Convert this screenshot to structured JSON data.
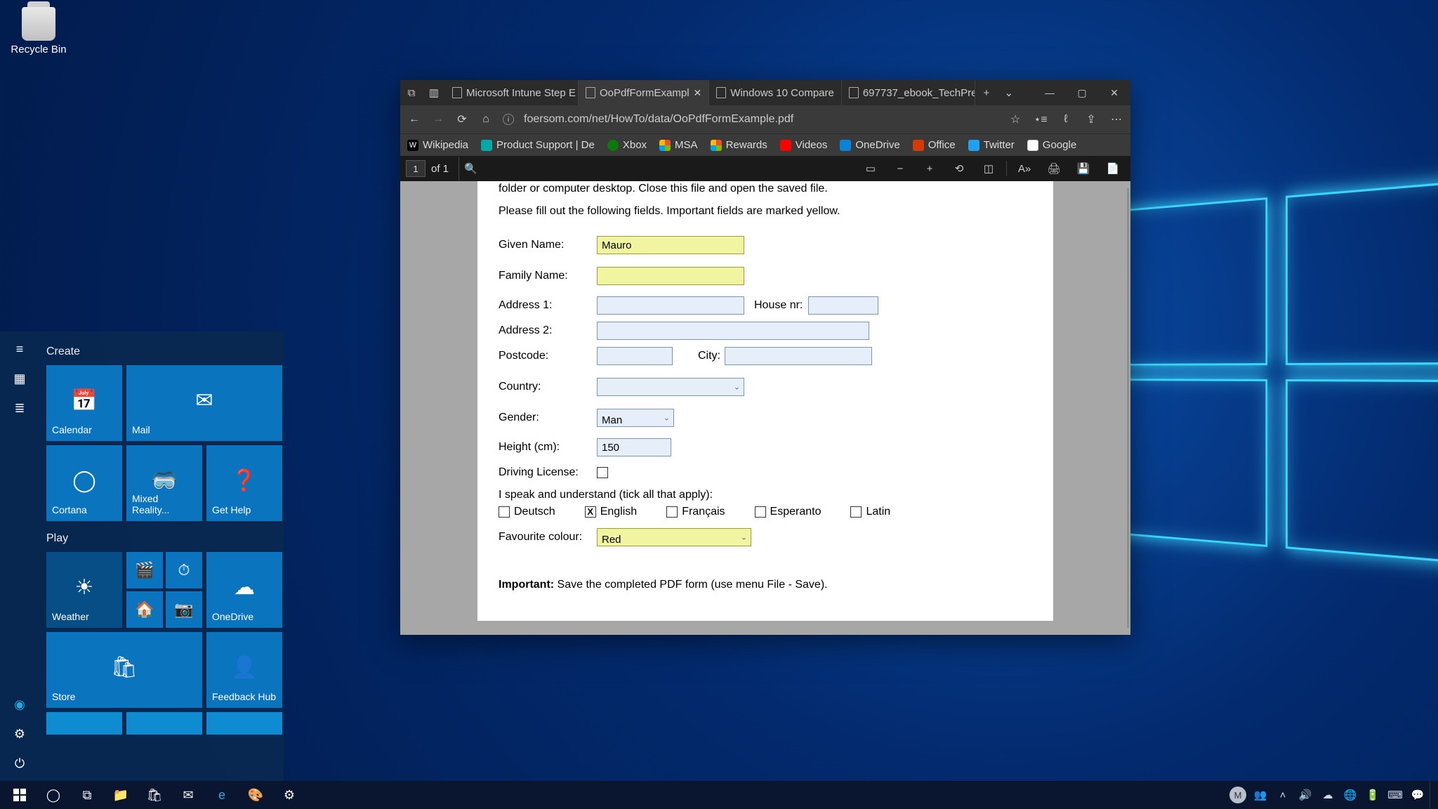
{
  "desktop": {
    "recycle_bin": "Recycle Bin"
  },
  "edge": {
    "tabs": [
      {
        "label": "Microsoft Intune Step E"
      },
      {
        "label": "OoPdfFormExampl"
      },
      {
        "label": "Windows 10 Compare"
      },
      {
        "label": "697737_ebook_TechPre"
      }
    ],
    "url": "foersom.com/net/HowTo/data/OoPdfFormExample.pdf",
    "bookmarks": [
      "Wikipedia",
      "Product Support | De",
      "Xbox",
      "MSA",
      "Rewards",
      "Videos",
      "OneDrive",
      "Office",
      "Twitter",
      "Google"
    ]
  },
  "pdfbar": {
    "page": "1",
    "of": "of 1"
  },
  "form": {
    "line1": "folder or computer desktop. Close this file and open the saved file.",
    "line2": "Please fill out the following fields. Important fields are marked yellow.",
    "labels": {
      "given": "Given Name:",
      "family": "Family Name:",
      "addr1": "Address 1:",
      "addr2": "Address 2:",
      "house": "House nr:",
      "postcode": "Postcode:",
      "city": "City:",
      "country": "Country:",
      "gender": "Gender:",
      "height": "Height (cm):",
      "license": "Driving License:",
      "langs": "I speak and understand (tick all that apply):",
      "fav": "Favourite colour:"
    },
    "values": {
      "given": "Mauro",
      "gender": "Man",
      "height": "150",
      "fav": "Red"
    },
    "langs": [
      "Deutsch",
      "English",
      "Français",
      "Esperanto",
      "Latin"
    ],
    "lang_checked": "English",
    "footer_bold": "Important:",
    "footer_rest": " Save the completed PDF form (use menu File - Save)."
  },
  "start": {
    "create": "Create",
    "play": "Play",
    "tiles": {
      "calendar": "Calendar",
      "mail": "Mail",
      "cortana": "Cortana",
      "mixed": "Mixed Reality...",
      "gethelp": "Get Help",
      "weather": "Weather",
      "onedrive": "OneDrive",
      "store": "Store",
      "feedback": "Feedback Hub"
    }
  },
  "taskbar": {
    "user_initial": "M"
  }
}
